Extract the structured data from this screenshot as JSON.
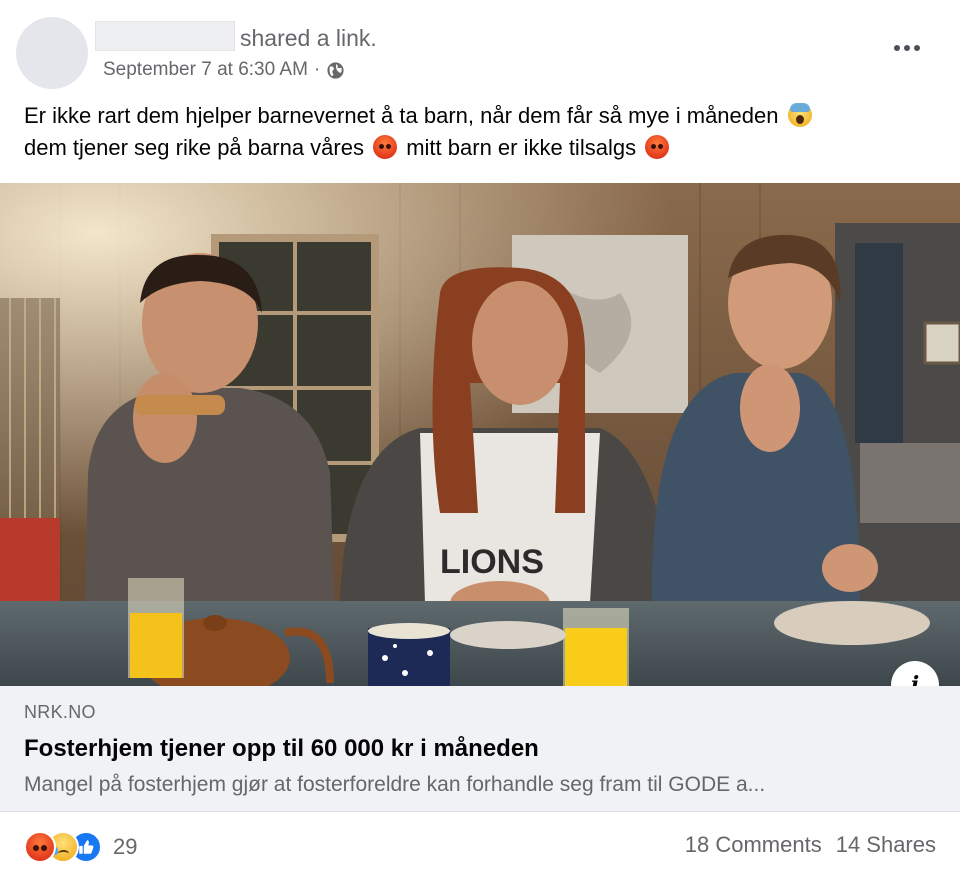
{
  "post": {
    "action_text": "shared a link.",
    "timestamp": "September 7 at 6:30 AM",
    "separator": "·",
    "privacy_icon": "globe-icon",
    "more_icon": "more-options-icon",
    "message": {
      "line1": "Er ikke rart dem hjelper barnevernet å ta barn, når dem får så mye i måneden",
      "line1_emoji": "face-screaming-in-fear",
      "line2_part1": "dem tjener seg rike på barna våres",
      "line2_emoji1": "pouting-face",
      "line2_part2": "mitt barn er ikke tilsalgs",
      "line2_emoji2": "pouting-face"
    }
  },
  "link_preview": {
    "image_alt": "Three young people eating at a kitchen table",
    "image_shirt_text": "LIONS",
    "info_label": "i",
    "domain": "NRK.NO",
    "title": "Fosterhjem tjener opp til 60 000 kr i måneden",
    "description": "Mangel på fosterhjem gjør at fosterforeldre kan forhandle seg fram til GODE a..."
  },
  "engagement": {
    "reactions": [
      "angry",
      "sad",
      "like"
    ],
    "reaction_count": "29",
    "comments": "18 Comments",
    "shares": "14 Shares"
  },
  "colors": {
    "secondary_text": "#65676b",
    "link_box_bg": "#f0f2f5",
    "like_blue": "#1877f2"
  }
}
